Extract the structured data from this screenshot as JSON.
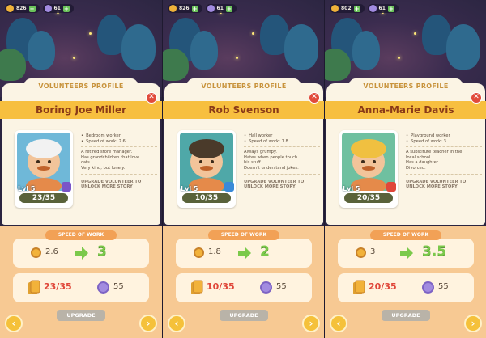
{
  "screens": [
    {
      "currency": {
        "coins": "826",
        "gems": "61"
      },
      "header": "VOLUNTEERS PROFILE",
      "name": "Boring Joe Miller",
      "level": "Lvl 5",
      "xp": "23/35",
      "details": {
        "role": "Bedroom worker",
        "speed": "Speed of work: 2.6",
        "bio": [
          "A retired store manager.",
          "Has grandchildren that love",
          "cats.",
          "Very kind, but lonely."
        ],
        "upgrade_note": [
          "UPGRADE VOLUNTEER TO",
          "UNLOCK MORE STORY"
        ]
      },
      "speed_label": "SPEED OF WORK",
      "speed_current": "2.6",
      "speed_next": "3",
      "cards": "23/35",
      "gems_cost": "55",
      "upgrade_label": "UPGRADE",
      "colors": {
        "portrait_bg": "#6fb8d8",
        "badge": "#7a55c8"
      }
    },
    {
      "currency": {
        "coins": "826",
        "gems": "61"
      },
      "header": "VOLUNTEERS PROFILE",
      "name": "Rob Svenson",
      "level": "Lvl 5",
      "xp": "10/35",
      "details": {
        "role": "Hall worker",
        "speed": "Speed of work: 1.8",
        "bio": [
          "Always grumpy.",
          "Hates when people touch",
          "his stuff.",
          "Doesn't understand jokes."
        ],
        "upgrade_note": [
          "UPGRADE VOLUNTEER TO",
          "UNLOCK MORE STORY"
        ]
      },
      "speed_label": "SPEED OF WORK",
      "speed_current": "1.8",
      "speed_next": "2",
      "cards": "10/35",
      "gems_cost": "55",
      "upgrade_label": "UPGRADE",
      "colors": {
        "portrait_bg": "#4fa8a8",
        "badge": "#3a8ad8"
      }
    },
    {
      "currency": {
        "coins": "802",
        "gems": "61"
      },
      "header": "VOLUNTEERS PROFILE",
      "name": "Anna-Marie Davis",
      "level": "Lvl 5",
      "xp": "20/35",
      "details": {
        "role": "Playground worker",
        "speed": "Speed of work: 3",
        "bio": [
          "A substitute teacher in the",
          "local school.",
          "Has a daughter.",
          "Divorced."
        ],
        "upgrade_note": [
          "UPGRADE VOLUNTEER TO",
          "UNLOCK MORE STORY"
        ]
      },
      "speed_label": "SPEED OF WORK",
      "speed_current": "3",
      "speed_next": "3.5",
      "cards": "20/35",
      "gems_cost": "55",
      "upgrade_label": "UPGRADE",
      "colors": {
        "portrait_bg": "#6fc0a0",
        "badge": "#e0473a"
      }
    }
  ]
}
